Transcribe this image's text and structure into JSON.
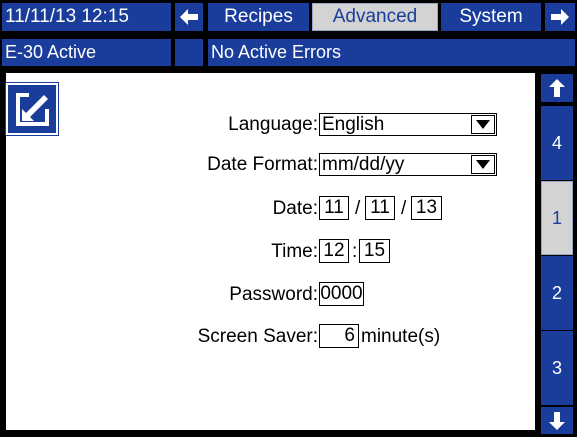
{
  "topbar": {
    "datetime": "11/11/13 12:15",
    "tabs": [
      {
        "label": "Recipes"
      },
      {
        "label": "Advanced"
      },
      {
        "label": "System"
      }
    ]
  },
  "statusbar": {
    "mode": "E-30 Active",
    "errors": "No Active Errors"
  },
  "form": {
    "language_label": "Language:",
    "language_value": "English",
    "date_format_label": "Date Format:",
    "date_format_value": "mm/dd/yy",
    "date_label": "Date:",
    "date_month": "11",
    "date_day": "11",
    "date_year": "13",
    "date_sep": "/",
    "time_label": "Time:",
    "time_hour": "12",
    "time_minute": "15",
    "time_sep": ":",
    "password_label": "Password:",
    "password_value": "0000",
    "screensaver_label": "Screen Saver:",
    "screensaver_value": "6",
    "screensaver_unit": "minute(s)"
  },
  "pages": [
    "4",
    "1",
    "2",
    "3"
  ],
  "current_page": "1",
  "colors": {
    "panel_blue": "#1a3d9b",
    "active_tab": "#d3d3d3",
    "background": "#000000"
  }
}
